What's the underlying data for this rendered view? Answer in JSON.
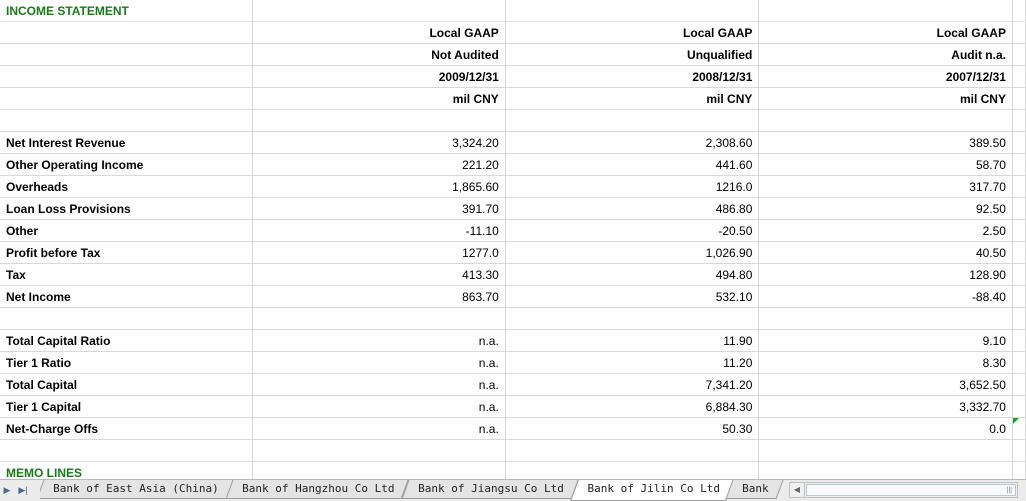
{
  "sheet": {
    "title": "INCOME STATEMENT",
    "headers": [
      [
        "Local GAAP",
        "Local GAAP",
        "Local GAAP"
      ],
      [
        "Not Audited",
        "Unqualified",
        "Audit n.a."
      ],
      [
        "2009/12/31",
        "2008/12/31",
        "2007/12/31"
      ],
      [
        "mil CNY",
        "mil CNY",
        "mil CNY"
      ]
    ],
    "income_rows": [
      {
        "label": "Net Interest Revenue",
        "values": [
          "3,324.20",
          "2,308.60",
          "389.50"
        ]
      },
      {
        "label": "Other Operating Income",
        "values": [
          "221.20",
          "441.60",
          "58.70"
        ]
      },
      {
        "label": "Overheads",
        "values": [
          "1,865.60",
          "1216.0",
          "317.70"
        ]
      },
      {
        "label": "Loan Loss Provisions",
        "values": [
          "391.70",
          "486.80",
          "92.50"
        ]
      },
      {
        "label": "Other",
        "values": [
          "-11.10",
          "-20.50",
          "2.50"
        ]
      },
      {
        "label": "Profit before Tax",
        "values": [
          "1277.0",
          "1,026.90",
          "40.50"
        ]
      },
      {
        "label": "Tax",
        "values": [
          "413.30",
          "494.80",
          "128.90"
        ]
      },
      {
        "label": "Net Income",
        "values": [
          "863.70",
          "532.10",
          "-88.40"
        ]
      }
    ],
    "capital_rows": [
      {
        "label": "Total Capital Ratio",
        "values": [
          "n.a.",
          "11.90",
          "9.10"
        ]
      },
      {
        "label": "Tier 1 Ratio",
        "values": [
          "n.a.",
          "11.20",
          "8.30"
        ]
      },
      {
        "label": "Total Capital",
        "values": [
          "n.a.",
          "7,341.20",
          "3,652.50"
        ]
      },
      {
        "label": "Tier 1 Capital",
        "values": [
          "n.a.",
          "6,884.30",
          "3,332.70"
        ]
      },
      {
        "label": "Net-Charge Offs",
        "values": [
          "n.a.",
          "50.30",
          "0.0"
        ]
      }
    ],
    "memo_title": "MEMO LINES"
  },
  "tabbar": {
    "tabs": [
      "Bank of East Asia (China)",
      "Bank of Hangzhou Co Ltd",
      "Bank of Jiangsu Co Ltd",
      "Bank of Jilin Co Ltd",
      "Bank"
    ],
    "active_index": 3,
    "accent_color": "#1a7a1a"
  }
}
